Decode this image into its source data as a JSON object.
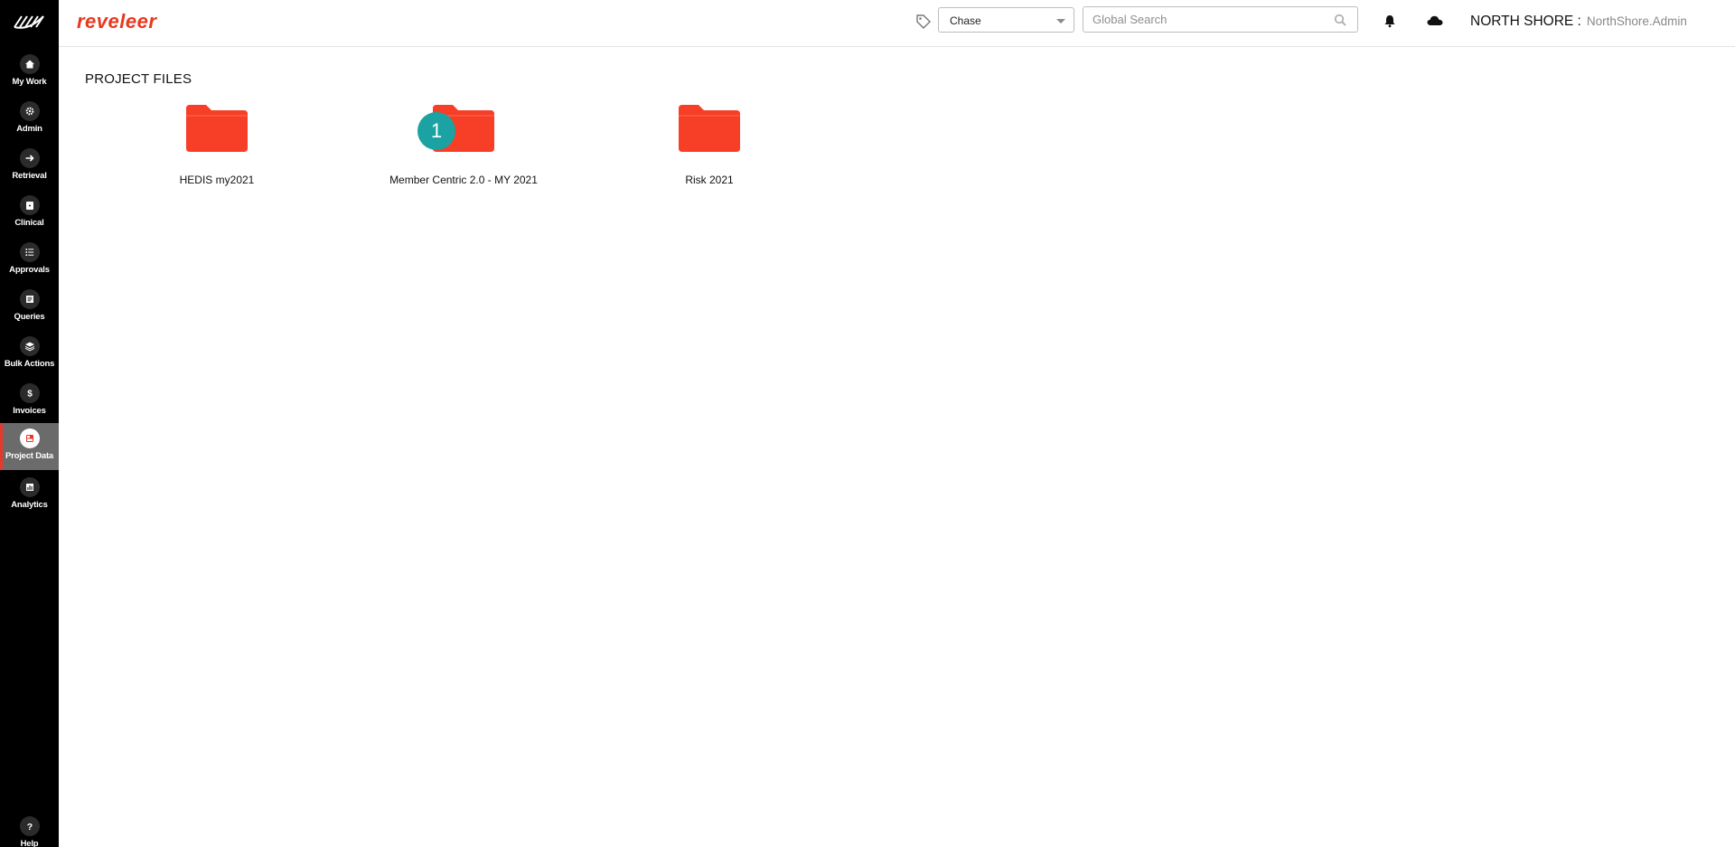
{
  "header": {
    "brand": "reveleer",
    "type_select": "Chase",
    "search_placeholder": "Global Search",
    "org": "NORTH SHORE :",
    "user": "NorthShore.Admin"
  },
  "sidebar": {
    "items": [
      {
        "label": "My Work",
        "icon": "home-icon"
      },
      {
        "label": "Admin",
        "icon": "gear-icon"
      },
      {
        "label": "Retrieval",
        "icon": "arrow-right-icon"
      },
      {
        "label": "Clinical",
        "icon": "clipboard-icon"
      },
      {
        "label": "Approvals",
        "icon": "list-icon"
      },
      {
        "label": "Queries",
        "icon": "document-icon"
      },
      {
        "label": "Bulk Actions",
        "icon": "layers-icon"
      },
      {
        "label": "Invoices",
        "icon": "dollar-icon"
      },
      {
        "label": "Project Data",
        "icon": "project-data-icon",
        "active": true
      },
      {
        "label": "Analytics",
        "icon": "chart-icon"
      }
    ],
    "help": "Help"
  },
  "main": {
    "title": "PROJECT FILES",
    "folders": [
      {
        "name": "HEDIS my2021"
      },
      {
        "name": "Member Centric 2.0 - MY 2021",
        "badge": "1"
      },
      {
        "name": "Risk 2021"
      }
    ]
  },
  "colors": {
    "brand": "#e8381e",
    "folder": "#f73e26",
    "badge": "#1aa3a2",
    "sidebar": "#000000",
    "active_nav": "#6b6b6b"
  }
}
